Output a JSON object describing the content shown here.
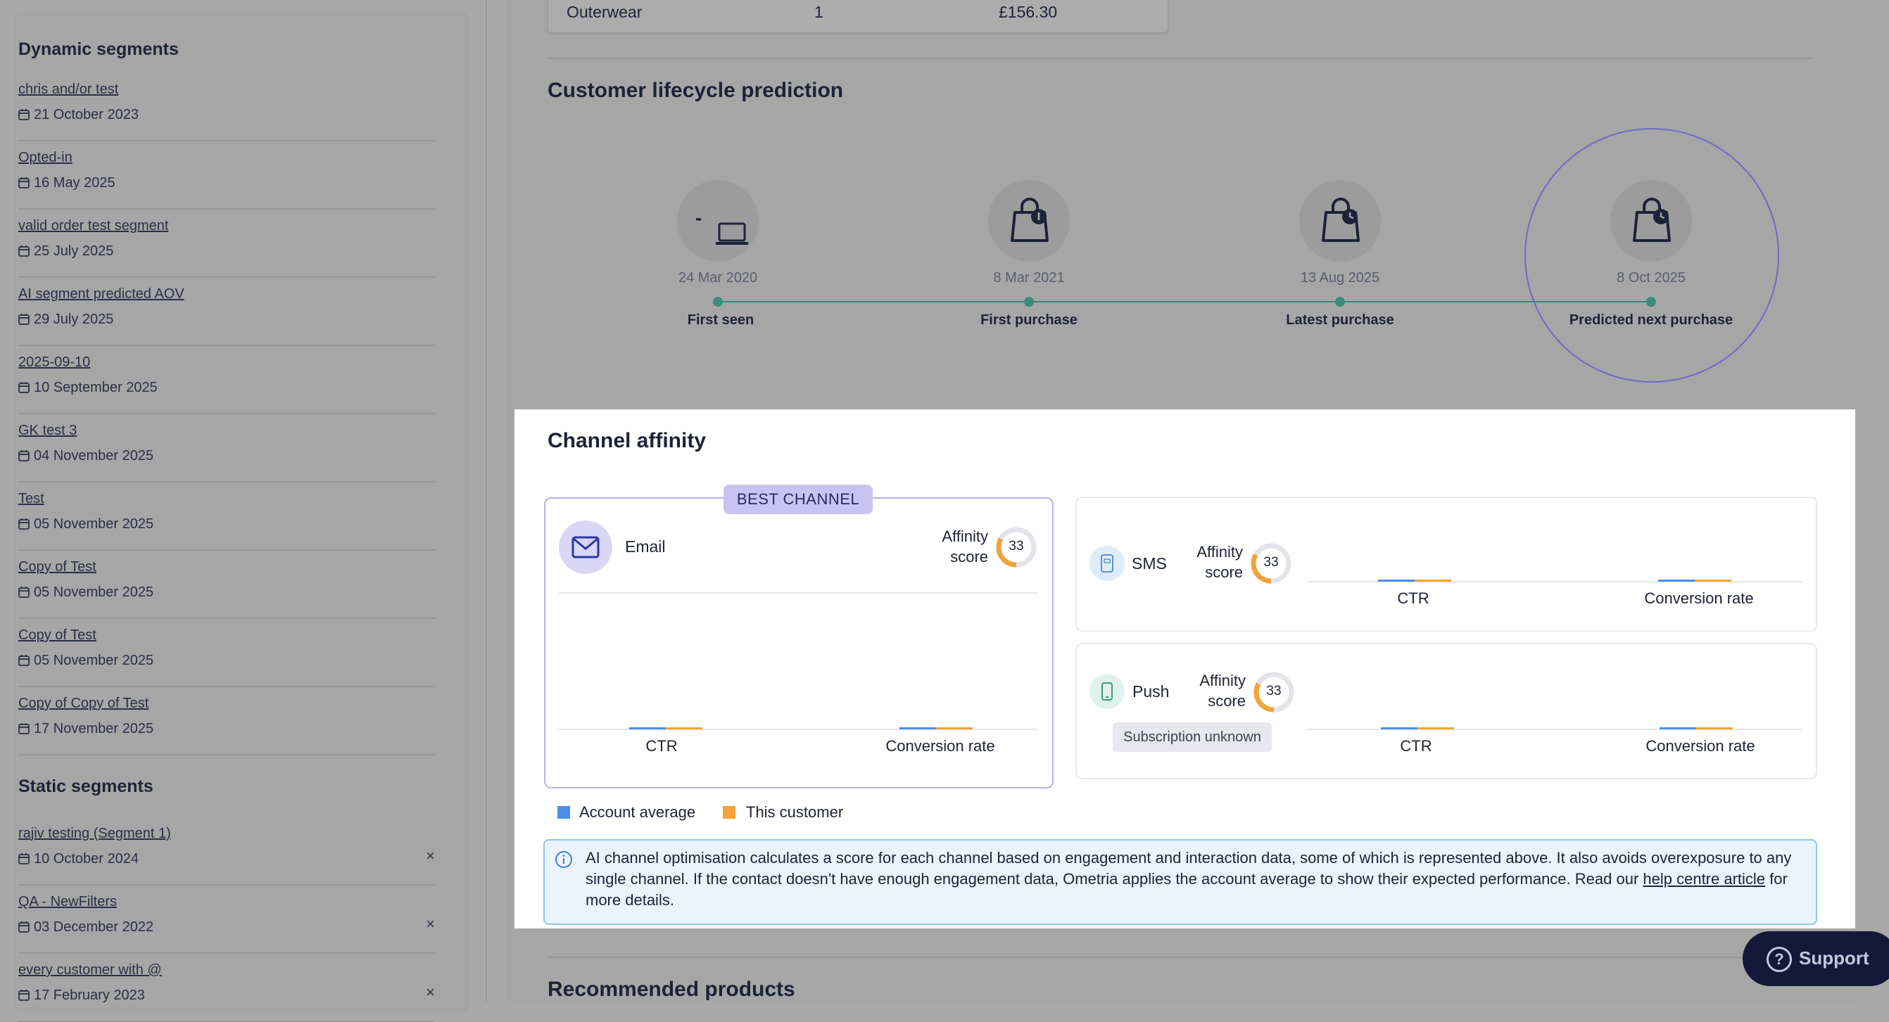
{
  "sidebar": {
    "dynamic_title": "Dynamic segments",
    "dynamic": [
      {
        "name": "chris and/or test",
        "date": "21 October 2023"
      },
      {
        "name": "Opted-in",
        "date": "16 May 2025"
      },
      {
        "name": "valid order test segment",
        "date": "25 July 2025"
      },
      {
        "name": "AI segment predicted AOV",
        "date": "29 July 2025"
      },
      {
        "name": "2025-09-10",
        "date": "10 September 2025"
      },
      {
        "name": "GK test 3",
        "date": "04 November 2025"
      },
      {
        "name": "Test",
        "date": "05 November 2025"
      },
      {
        "name": "Copy of Test",
        "date": "05 November 2025"
      },
      {
        "name": "Copy of Test",
        "date": "05 November 2025"
      },
      {
        "name": "Copy of Copy of Test",
        "date": "17 November 2025"
      }
    ],
    "static_title": "Static segments",
    "static": [
      {
        "name": "rajiv testing (Segment 1)",
        "date": "10 October 2024"
      },
      {
        "name": "QA - NewFilters",
        "date": "03 December 2022"
      },
      {
        "name": "every customer with @",
        "date": "17 February 2023"
      }
    ],
    "remove_glyph": "×"
  },
  "prev_row": {
    "category": "Outerwear",
    "count": "1",
    "value": "£156.30"
  },
  "lifecycle": {
    "title": "Customer lifecycle prediction",
    "stages": [
      {
        "date": "24 Mar 2020",
        "label": "First seen",
        "icon": "laptop-icon",
        "dash": "-"
      },
      {
        "date": "8 Mar 2021",
        "label": "First purchase",
        "icon": "shopping-bag-icon"
      },
      {
        "date": "13 Aug 2025",
        "label": "Latest purchase",
        "icon": "shopping-bag-clock-icon"
      },
      {
        "date": "8 Oct 2025",
        "label": "Predicted next purchase",
        "icon": "shopping-bag-clock-icon"
      }
    ]
  },
  "channel": {
    "title": "Channel affinity",
    "best_badge": "BEST CHANNEL",
    "affinity_line1": "Affinity",
    "affinity_line2": "score",
    "email": {
      "name": "Email",
      "score": "33",
      "score_value": 33
    },
    "sms": {
      "name": "SMS",
      "score": "33",
      "score_value": 33
    },
    "push": {
      "name": "Push",
      "score": "33",
      "score_value": 33,
      "note": "Subscription unknown"
    },
    "metric_ctr": "CTR",
    "metric_conv": "Conversion rate",
    "legend_account": "Account average",
    "legend_customer": "This customer",
    "colors": {
      "account": "#4a8fe6",
      "customer": "#f0a43a",
      "accent": "#6d69c5"
    }
  },
  "info": {
    "text_before": "AI channel optimisation calculates a score for each channel based on engagement and interaction data, some of which is represented above. It also avoids overexposure to any single channel. If the contact doesn't have enough engagement data, Ometria applies the account average to show their expected performance. Read our ",
    "link": "help centre article",
    "text_after": " for more details."
  },
  "recommended_title": "Recommended products",
  "support_label": "Support"
}
